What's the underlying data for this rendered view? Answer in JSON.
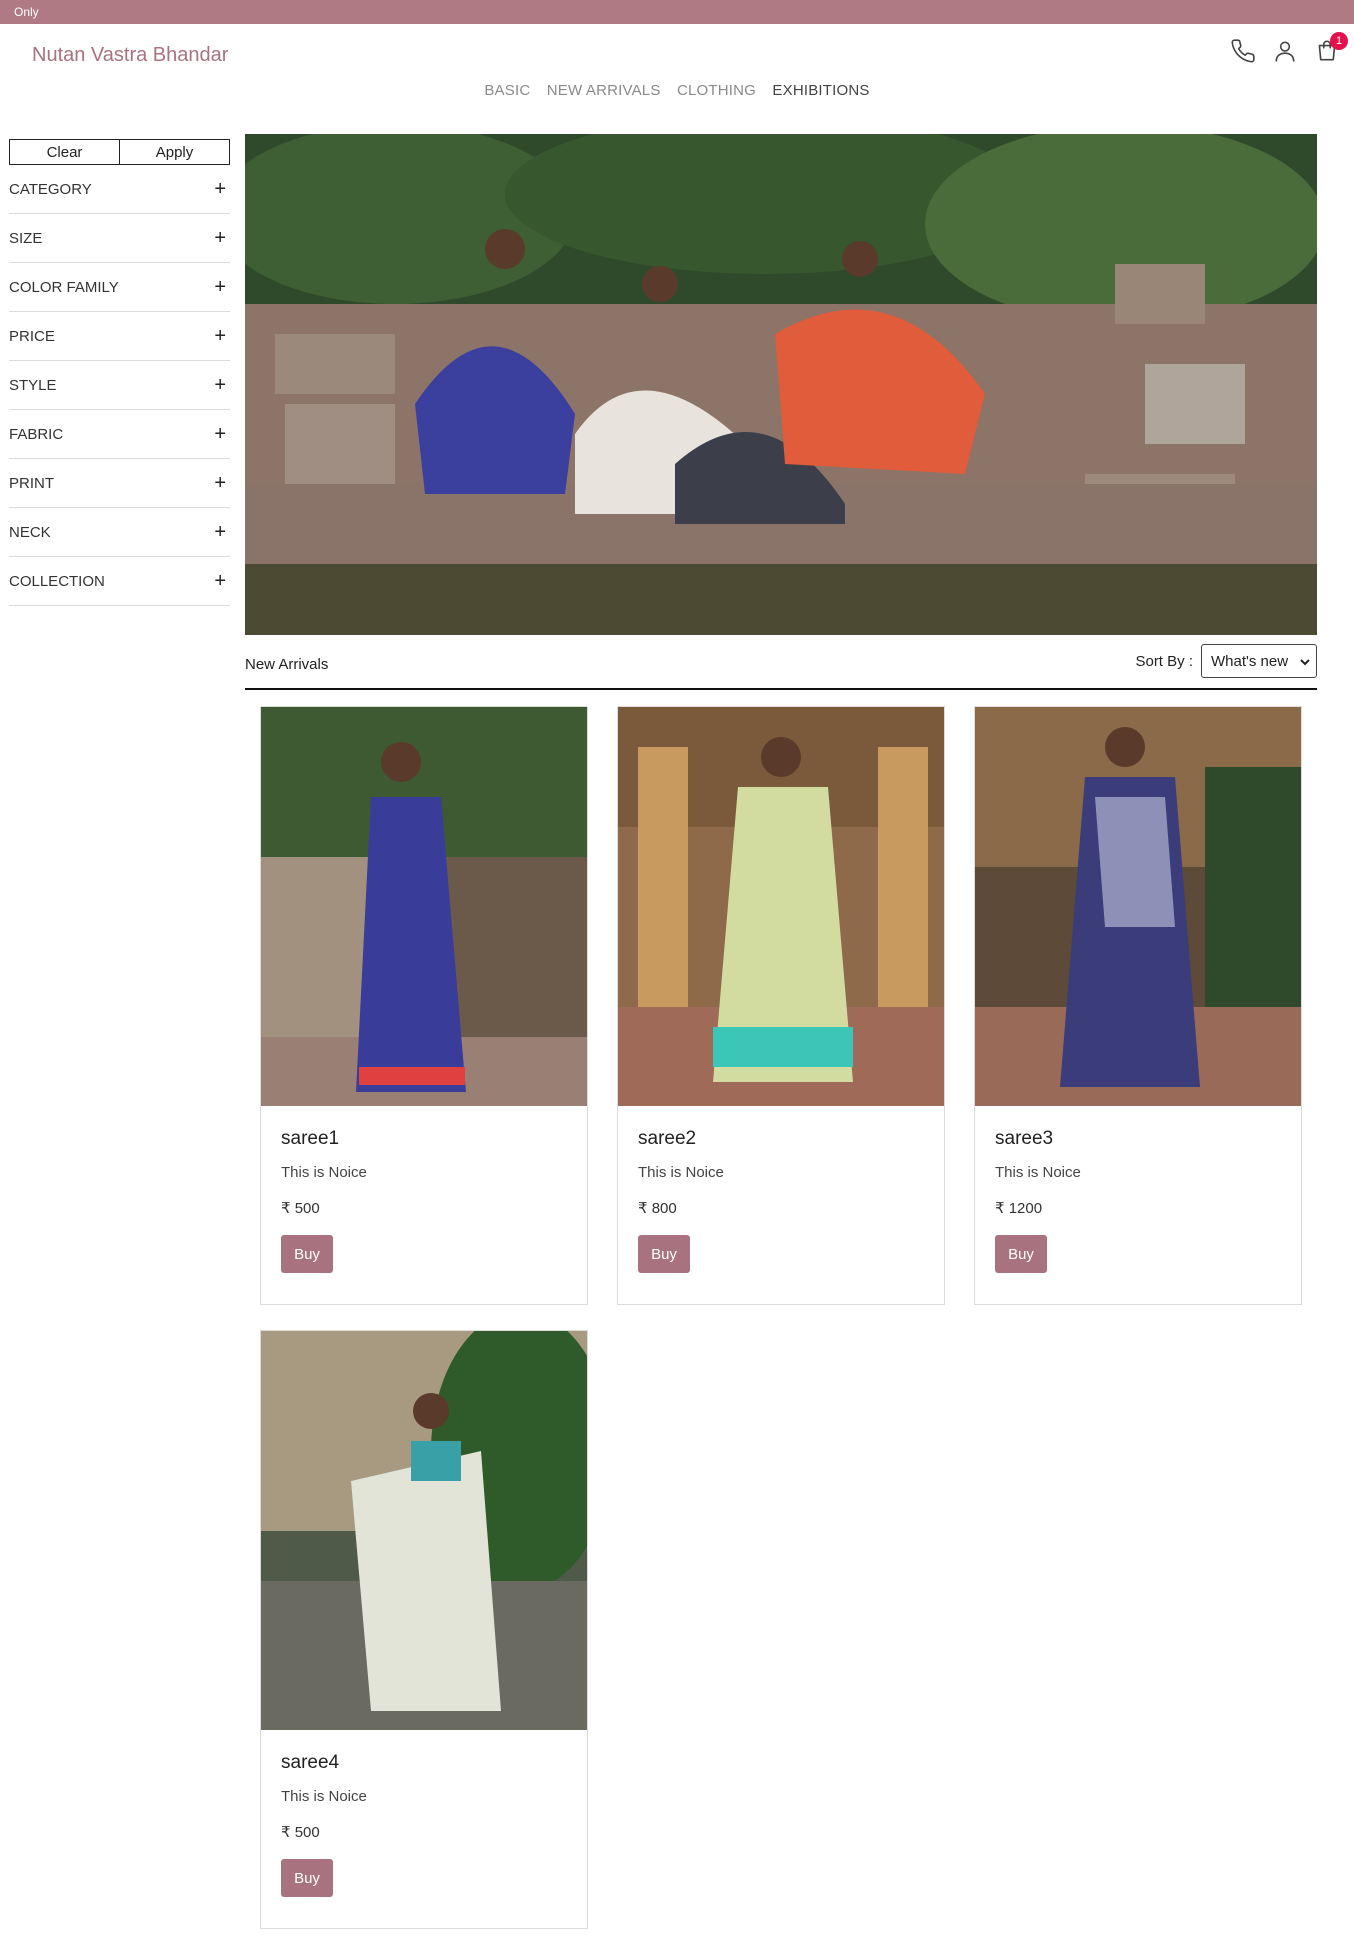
{
  "announcement": "Only",
  "brand": "Nutan Vastra Bhandar",
  "nav": [
    "BASIC",
    "NEW ARRIVALS",
    "CLOTHING",
    "EXHIBITIONS"
  ],
  "cart_count": "1",
  "icons": {
    "phone": "phone-icon",
    "account": "user-icon",
    "cart": "cart-icon"
  },
  "colors": {
    "brand": "#a8737e",
    "topbar": "#b07a84",
    "badge": "#e3114c"
  },
  "sidebar": {
    "clear_label": "Clear",
    "apply_label": "Apply",
    "filters": [
      "CATEGORY",
      "SIZE",
      "COLOR FAMILY",
      "PRICE",
      "STYLE",
      "FABRIC",
      "PRINT",
      "NECK",
      "COLLECTION"
    ],
    "expand_symbol": "+"
  },
  "listing": {
    "title": "New Arrivals",
    "sort_label": "Sort By :",
    "sort_value": "What's new"
  },
  "products": [
    {
      "name": "saree1",
      "description": "This is Noice",
      "price": "₹ 500",
      "buy_label": "Buy"
    },
    {
      "name": "saree2",
      "description": "This is Noice",
      "price": "₹ 800",
      "buy_label": "Buy"
    },
    {
      "name": "saree3",
      "description": "This is Noice",
      "price": "₹ 1200",
      "buy_label": "Buy"
    },
    {
      "name": "saree4",
      "description": "This is Noice",
      "price": "₹ 500",
      "buy_label": "Buy"
    }
  ]
}
